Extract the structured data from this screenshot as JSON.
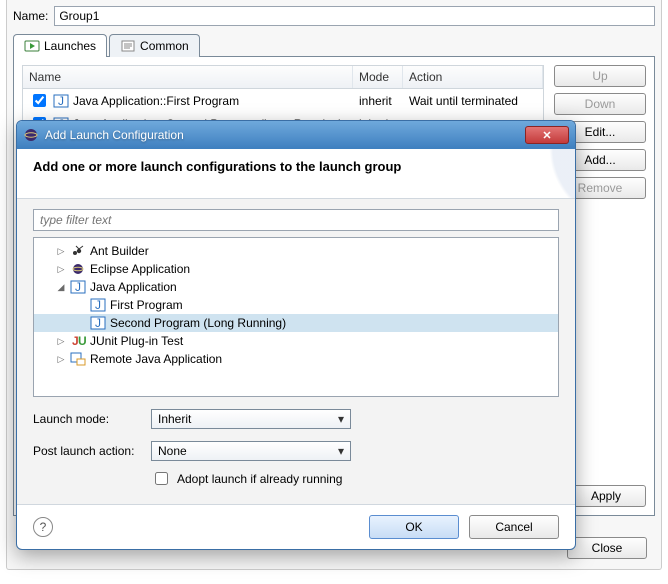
{
  "name_label": "Name:",
  "group_name": "Group1",
  "tabs": {
    "launches": "Launches",
    "common": "Common"
  },
  "table": {
    "headers": {
      "name": "Name",
      "mode": "Mode",
      "action": "Action"
    },
    "rows": [
      {
        "checked": true,
        "label": "Java Application::First Program",
        "mode": "inherit",
        "action": "Wait until terminated"
      },
      {
        "checked": true,
        "label": "Java Application::Second Program (Long Running)",
        "mode": "inherit",
        "action": ""
      }
    ]
  },
  "side": {
    "up": "Up",
    "down": "Down",
    "edit": "Edit...",
    "add": "Add...",
    "remove": "Remove"
  },
  "bottom": {
    "apply": "Apply"
  },
  "footer": {
    "close": "Close"
  },
  "dialog": {
    "title": "Add Launch Configuration",
    "heading": "Add one or more launch configurations to the launch group",
    "filter_placeholder": "type filter text",
    "tree": {
      "ant": "Ant Builder",
      "eclipse": "Eclipse Application",
      "java": "Java Application",
      "first": "First Program",
      "second": "Second Program (Long Running)",
      "junit": "JUnit Plug-in Test",
      "remote": "Remote Java Application"
    },
    "launch_mode_label": "Launch mode:",
    "launch_mode_value": "Inherit",
    "post_action_label": "Post launch action:",
    "post_action_value": "None",
    "adopt_label": "Adopt launch if already running",
    "ok": "OK",
    "cancel": "Cancel"
  }
}
